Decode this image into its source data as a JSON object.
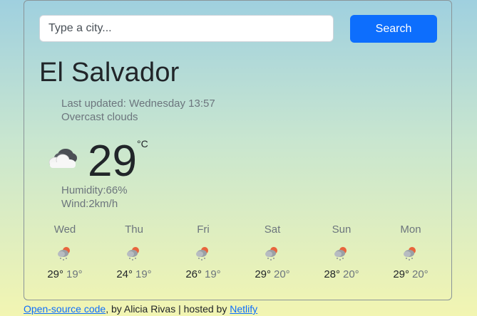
{
  "search": {
    "placeholder": "Type a city...",
    "button_label": "Search"
  },
  "current": {
    "city": "El Salvador",
    "last_updated": "Last updated: Wednesday 13:57",
    "description": "Overcast clouds",
    "icon": "overcast-cloud-icon",
    "temperature": "29",
    "unit": "°C",
    "humidity": "Humidity:66%",
    "wind": "Wind:2km/h"
  },
  "forecast": [
    {
      "day": "Wed",
      "max": "29°",
      "min": "19°",
      "icon": "rain-sun-icon"
    },
    {
      "day": "Thu",
      "max": "24°",
      "min": "19°",
      "icon": "rain-sun-icon"
    },
    {
      "day": "Fri",
      "max": "26°",
      "min": "19°",
      "icon": "rain-sun-icon"
    },
    {
      "day": "Sat",
      "max": "29°",
      "min": "20°",
      "icon": "rain-sun-icon"
    },
    {
      "day": "Sun",
      "max": "28°",
      "min": "20°",
      "icon": "rain-sun-icon"
    },
    {
      "day": "Mon",
      "max": "29°",
      "min": "20°",
      "icon": "rain-sun-icon"
    }
  ],
  "footer": {
    "source_link": "Open-source code",
    "by_text": ", by Alicia Rivas | hosted by ",
    "host_link": "Netlify"
  },
  "colors": {
    "accent": "#0d6efd",
    "bg_top": "#9fd0df",
    "bg_bottom": "#f2f5b2"
  }
}
